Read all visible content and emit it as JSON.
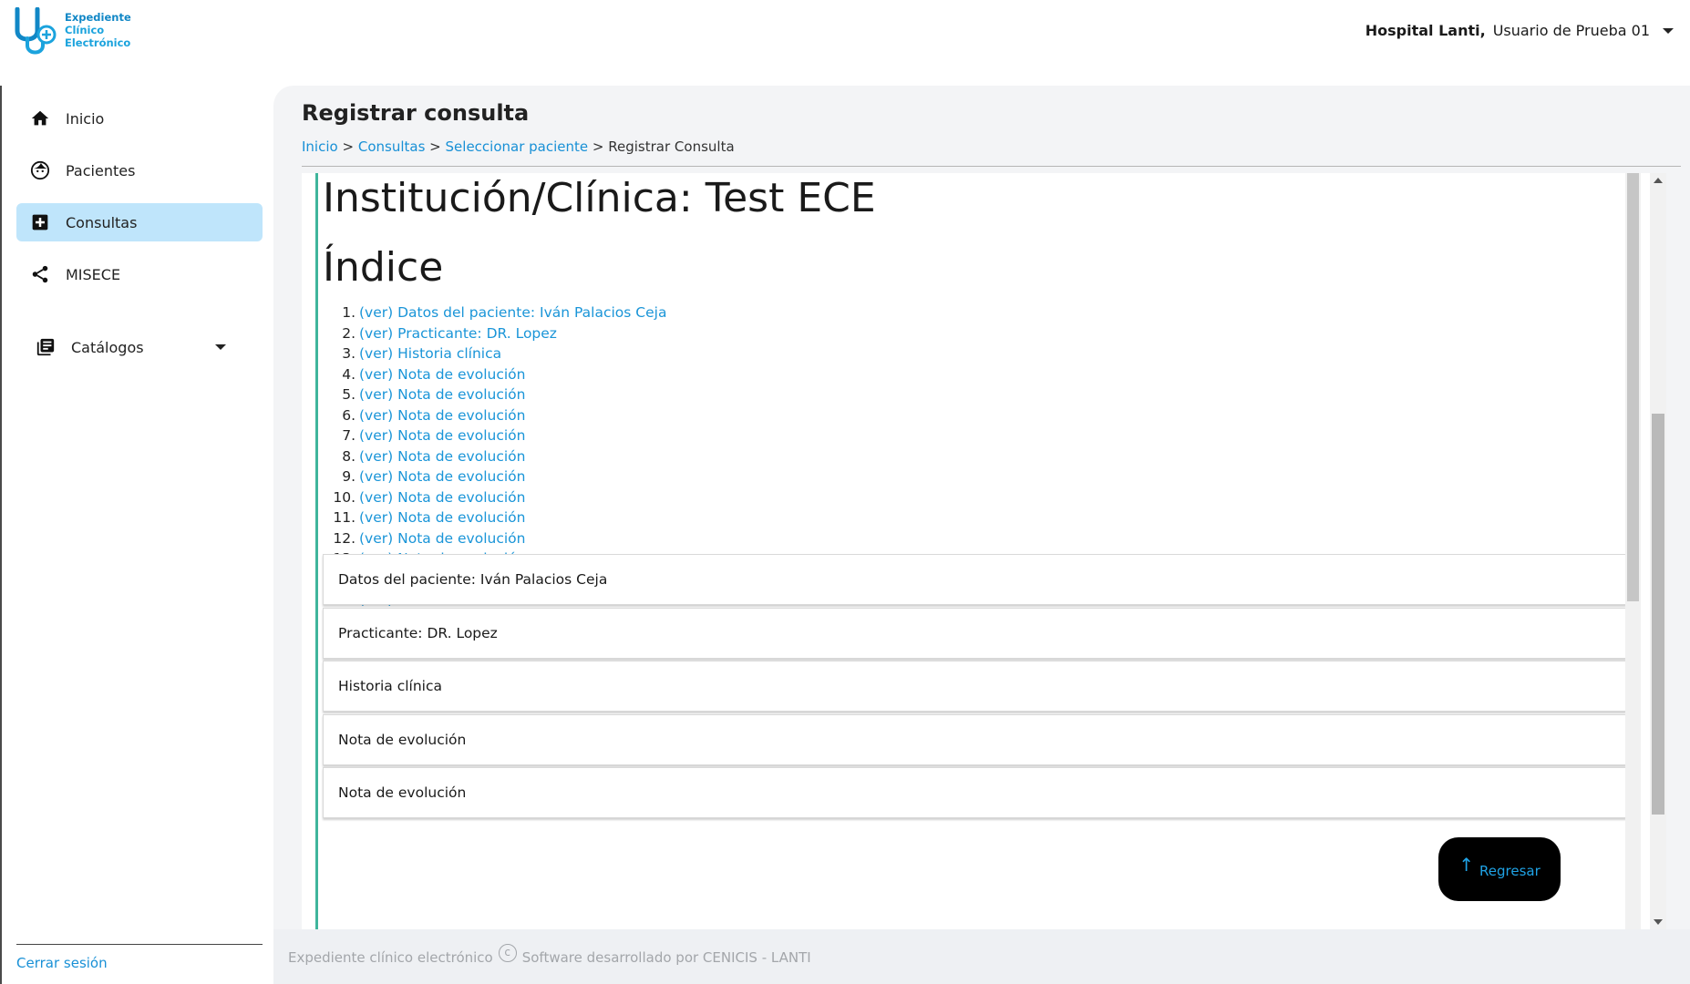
{
  "header": {
    "logo_text": [
      "Expediente",
      "Clínico",
      "Electrónico"
    ],
    "hospital": "Hospital Lanti,",
    "user": "Usuario de Prueba 01"
  },
  "sidebar": {
    "items": [
      {
        "label": "Inicio",
        "icon": "home-icon",
        "active": false
      },
      {
        "label": "Pacientes",
        "icon": "face-icon",
        "active": false
      },
      {
        "label": "Consultas",
        "icon": "medical-plus-icon",
        "active": true
      },
      {
        "label": "MISECE",
        "icon": "share-icon",
        "active": false
      }
    ],
    "catalogs_label": "Catálogos",
    "logout_label": "Cerrar sesión"
  },
  "main": {
    "title": "Registrar consulta",
    "breadcrumb": {
      "inicio": "Inicio",
      "consultas": "Consultas",
      "seleccionar": "Seleccionar paciente",
      "current": "Registrar Consulta",
      "sep": ">"
    },
    "doc_title": "Institución/Clínica: Test ECE",
    "index_title": "Índice",
    "index": [
      {
        "num": "1.",
        "ver": "(ver)",
        "text": "Datos del paciente: Iván Palacios Ceja"
      },
      {
        "num": "2.",
        "ver": "(ver)",
        "text": "Practicante: DR. Lopez"
      },
      {
        "num": "3.",
        "ver": "(ver)",
        "text": "Historia clínica"
      },
      {
        "num": "4.",
        "ver": "(ver)",
        "text": "Nota de evolución"
      },
      {
        "num": "5.",
        "ver": "(ver)",
        "text": "Nota de evolución"
      },
      {
        "num": "6.",
        "ver": "(ver)",
        "text": "Nota de evolución"
      },
      {
        "num": "7.",
        "ver": "(ver)",
        "text": "Nota de evolución"
      },
      {
        "num": "8.",
        "ver": "(ver)",
        "text": "Nota de evolución"
      },
      {
        "num": "9.",
        "ver": "(ver)",
        "text": "Nota de evolución"
      },
      {
        "num": "10.",
        "ver": "(ver)",
        "text": "Nota de evolución"
      },
      {
        "num": "11.",
        "ver": "(ver)",
        "text": "Nota de evolución"
      },
      {
        "num": "12.",
        "ver": "(ver)",
        "text": "Nota de evolución"
      },
      {
        "num": "13.",
        "ver": "(ver)",
        "text": "Nota de evolución"
      },
      {
        "num": "14.",
        "ver": "(ver)",
        "text": "Nota de evolución"
      },
      {
        "num": "15.",
        "ver": "(ver)",
        "text": "Nota de evolución"
      }
    ],
    "sections": [
      "Datos del paciente: Iván Palacios Ceja",
      "Practicante: DR. Lopez",
      "Historia clínica",
      "Nota de evolución",
      "Nota de evolución"
    ],
    "back_button": "Regresar"
  },
  "footer": {
    "left": "Expediente clínico electrónico",
    "copyright_symbol": "c",
    "right": "Software desarrollado por CENICIS - LANTI"
  },
  "colors": {
    "accent": "#1890d6",
    "active_nav": "#bfe5fb",
    "doc_bar": "#3fb59c"
  }
}
